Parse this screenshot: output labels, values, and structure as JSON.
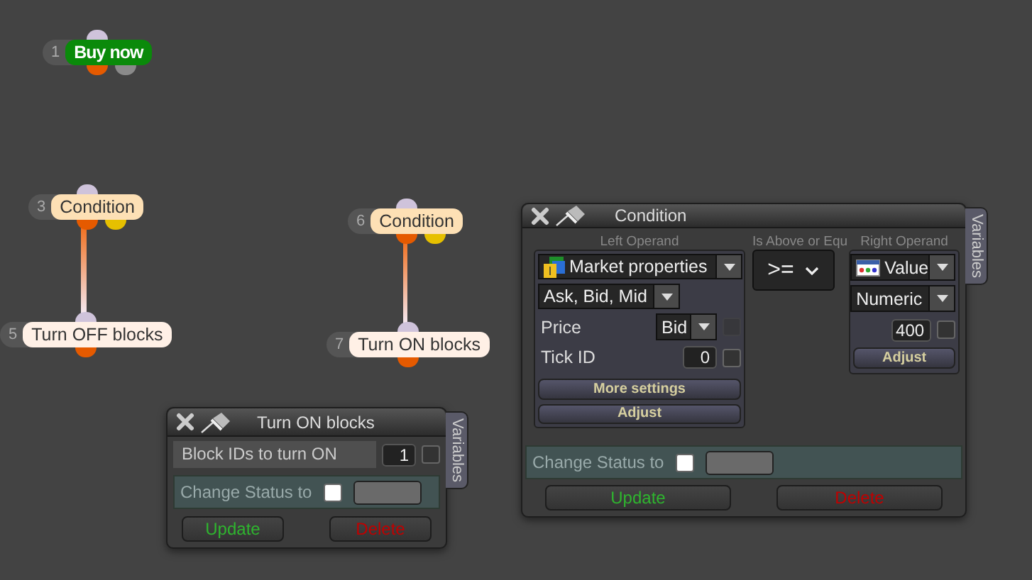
{
  "nodes": [
    {
      "number": "1",
      "label": "Buy now",
      "kind": "action"
    },
    {
      "number": "3",
      "label": "Condition",
      "kind": "condition",
      "children": [
        {
          "number": "5",
          "label": "Turn OFF blocks",
          "kind": "block"
        }
      ]
    },
    {
      "number": "6",
      "label": "Condition",
      "kind": "condition",
      "children": [
        {
          "number": "7",
          "label": "Turn ON blocks",
          "kind": "block"
        }
      ]
    }
  ],
  "turn_on_panel": {
    "title": "Turn ON blocks",
    "side_tab": "Variables",
    "field_label": "Block IDs to turn ON",
    "field_value": "1",
    "field_checked": false,
    "status": {
      "label": "Change Status to",
      "checked": false
    },
    "buttons": [
      {
        "label": "Update",
        "kind": "update"
      },
      {
        "label": "Delete",
        "kind": "delete"
      }
    ]
  },
  "condition_panel": {
    "title": "Condition",
    "side_tab": "Variables",
    "left_heading": "Left Operand",
    "middle_heading": "Is Above or Equ",
    "right_heading": "Right Operand",
    "left": {
      "source": "Market properties",
      "property": "Ask, Bid, Mid",
      "rows": [
        {
          "kind": "dropdown",
          "label": "Price",
          "value": "Bid",
          "checked": false,
          "disabled": true
        },
        {
          "kind": "field",
          "label": "Tick ID",
          "value": "0",
          "checked": false,
          "disabled": false
        }
      ],
      "buttons": [
        "More settings",
        "Adjust"
      ]
    },
    "operator": ">=",
    "right": {
      "source": "Value",
      "type": "Numeric",
      "value": "400",
      "checked": false,
      "button": "Adjust"
    },
    "status": {
      "label": "Change Status to",
      "checked": false
    },
    "buttons": [
      {
        "label": "Update",
        "kind": "update"
      },
      {
        "label": "Delete",
        "kind": "delete"
      }
    ]
  }
}
